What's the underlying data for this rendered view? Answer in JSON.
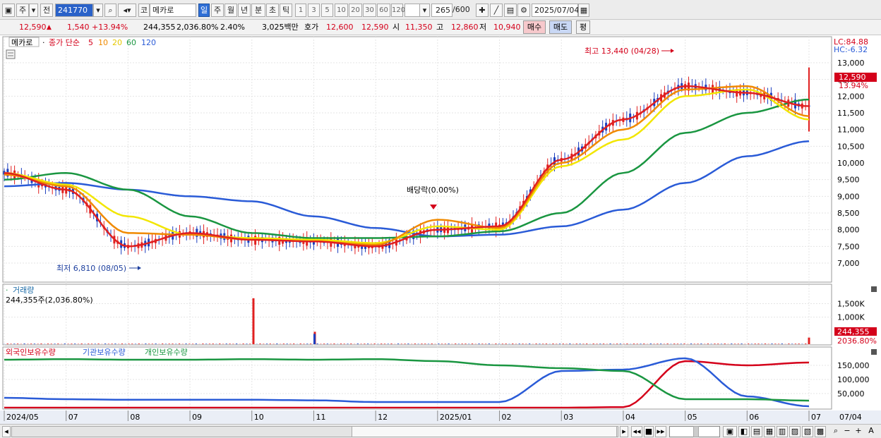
{
  "toolbar": {
    "market": "주",
    "prev_label": "전",
    "symbol": "241770",
    "market_code": "코",
    "name": "메카로",
    "periods": [
      "일",
      "주",
      "월",
      "년",
      "분",
      "초",
      "틱"
    ],
    "selected_period": "일",
    "intervals": [
      "1",
      "3",
      "5",
      "10",
      "20",
      "30",
      "60",
      "120"
    ],
    "count": "265",
    "count_max": "/600",
    "date": "2025/07/04"
  },
  "quote": {
    "price": "12,590",
    "change": "1,540",
    "change_pct": "+13.94%",
    "volume": "244,355",
    "volume_ratio": "2,036.80%",
    "turnover": "2.40%",
    "amount": "3,025백만",
    "ask_label": "호가",
    "ask": "12,600",
    "bid": "12,590",
    "open_label": "시",
    "open": "11,350",
    "high_label": "고",
    "high": "12,860",
    "low_label": "저",
    "low": "10,940",
    "buy_label": "매수",
    "sell_label": "매도",
    "eval_label": "평"
  },
  "legend": {
    "name": "메카로",
    "price_type": "종가 단순",
    "ma": [
      {
        "label": "5",
        "color": "#e02020"
      },
      {
        "label": "10",
        "color": "#f08a00"
      },
      {
        "label": "20",
        "color": "#e6d800"
      },
      {
        "label": "60",
        "color": "#1a9641"
      },
      {
        "label": "120",
        "color": "#2a5bd7"
      }
    ]
  },
  "price_axis": {
    "labels": [
      "13,000",
      "12,500",
      "12,000",
      "11,500",
      "11,000",
      "10,500",
      "10,000",
      "9,500",
      "9,000",
      "8,500",
      "8,000",
      "7,500",
      "7,000"
    ],
    "lc": "LC:84.88",
    "hc": "HC:-6.32",
    "current": "12,590",
    "current_pct": "13.94%"
  },
  "annotations": {
    "high": "최고 13,440 (04/28)",
    "low": "최저 6,810 (08/05)",
    "dividend": "배당락(0.00%)"
  },
  "volume_panel": {
    "title": "거래량",
    "value": "244,355주(2,036.80%)",
    "labels": [
      "1,500K",
      "1,000K"
    ],
    "current": "244,355",
    "current_pct": "2036.80%"
  },
  "holdings_panel": {
    "series": [
      {
        "name": "외국인보유수량",
        "color": "#d4001a"
      },
      {
        "name": "기관보유수량",
        "color": "#2a5bd7"
      },
      {
        "name": "개인보유수량",
        "color": "#1a9641"
      }
    ],
    "labels": [
      "150,000",
      "100,000",
      "50,000"
    ]
  },
  "x_axis": [
    "2024/05",
    "07",
    "08",
    "09",
    "10",
    "11",
    "12",
    "2025/01",
    "02",
    "03",
    "04",
    "05",
    "06",
    "07",
    "07/04"
  ],
  "chart_data": [
    {
      "type": "line",
      "title": "메카로",
      "ylim": [
        6500,
        13700
      ],
      "x": [
        "2024/05",
        "07",
        "08",
        "09",
        "10",
        "11",
        "12",
        "2025/01",
        "02",
        "03",
        "04",
        "05",
        "06",
        "07"
      ],
      "series": [
        {
          "name": "5",
          "values": [
            9700,
            9200,
            7500,
            7900,
            7700,
            7650,
            7500,
            8000,
            8100,
            10100,
            11300,
            12300,
            12100,
            11700
          ]
        },
        {
          "name": "10",
          "values": [
            9650,
            9300,
            7900,
            7850,
            7700,
            7650,
            7550,
            8300,
            8050,
            10000,
            11000,
            12200,
            12300,
            11400
          ]
        },
        {
          "name": "20",
          "values": [
            9700,
            9350,
            8400,
            7850,
            7750,
            7700,
            7600,
            8100,
            8000,
            9900,
            10700,
            12000,
            12200,
            11300
          ]
        },
        {
          "name": "60",
          "values": [
            9500,
            9700,
            9200,
            8400,
            7900,
            7750,
            7750,
            7800,
            7950,
            8500,
            9700,
            10900,
            11500,
            11900
          ]
        },
        {
          "name": "120",
          "values": [
            9300,
            9400,
            9200,
            9000,
            8850,
            8400,
            8050,
            7800,
            7850,
            8100,
            8600,
            9400,
            10200,
            10650
          ]
        }
      ],
      "annotations": {
        "high": 13440,
        "low": 6810
      }
    },
    {
      "type": "bar",
      "title": "거래량",
      "unit": "K",
      "ylim": [
        0,
        1800
      ],
      "spikes": [
        {
          "x": "10",
          "value": 1700
        },
        {
          "x": "11",
          "value": 460
        },
        {
          "x": "07",
          "value": 244.355
        }
      ]
    },
    {
      "type": "line",
      "ylim": [
        0,
        190000
      ],
      "x": [
        "2024/05",
        "07",
        "08",
        "09",
        "10",
        "11",
        "12",
        "2025/01",
        "02",
        "03",
        "04",
        "05",
        "06",
        "07"
      ],
      "series": [
        {
          "name": "외국인보유수량",
          "values": [
            0,
            0,
            0,
            0,
            0,
            0,
            0,
            0,
            0,
            0,
            2000,
            165000,
            150000,
            160000
          ]
        },
        {
          "name": "기관보유수량",
          "values": [
            35000,
            30000,
            28000,
            28000,
            28000,
            26000,
            20000,
            20000,
            20000,
            130000,
            135000,
            175000,
            40000,
            5000
          ]
        },
        {
          "name": "개인보유수량",
          "values": [
            170000,
            172000,
            170000,
            170000,
            172000,
            170000,
            172000,
            165000,
            150000,
            140000,
            130000,
            30000,
            30000,
            25000
          ]
        }
      ]
    }
  ],
  "bottom": {
    "zoom_minus": "−",
    "zoom_plus": "+",
    "font_label": "A"
  }
}
